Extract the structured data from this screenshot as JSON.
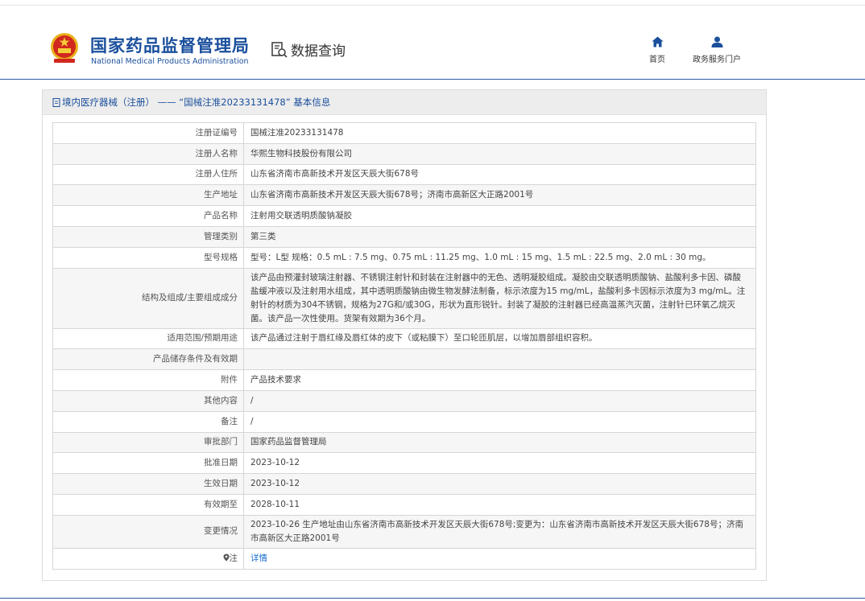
{
  "header": {
    "logo_cn": "国家药品监督管理局",
    "logo_en": "National Medical Products Administration",
    "query_label": "数据查询",
    "nav": {
      "home": "首页",
      "portal": "政务服务门户"
    }
  },
  "panel": {
    "title": "境内医疗器械（注册） —— “国械注准20233131478” 基本信息"
  },
  "rows": [
    {
      "label": "注册证编号",
      "value": "国械注准20233131478"
    },
    {
      "label": "注册人名称",
      "value": "华熙生物科技股份有限公司"
    },
    {
      "label": "注册人住所",
      "value": "山东省济南市高新技术开发区天辰大街678号"
    },
    {
      "label": "生产地址",
      "value": "山东省济南市高新技术开发区天辰大街678号；济南市高新区大正路2001号"
    },
    {
      "label": "产品名称",
      "value": "注射用交联透明质酸钠凝胶"
    },
    {
      "label": "管理类别",
      "value": "第三类"
    },
    {
      "label": "型号规格",
      "value": "型号：L型 规格：0.5 mL : 7.5 mg、0.75 mL : 11.25 mg、1.0 mL : 15 mg、1.5 mL : 22.5 mg、2.0 mL : 30 mg。"
    },
    {
      "label": "结构及组成/主要组成成分",
      "value": "该产品由预灌封玻璃注射器、不锈钢注射针和封装在注射器中的无色、透明凝胶组成。凝胶由交联透明质酸钠、盐酸利多卡因、磷酸盐缓冲液以及注射用水组成，其中透明质酸钠由微生物发酵法制备，标示浓度为15 mg/mL，盐酸利多卡因标示浓度为3 mg/mL。注射针的材质为304不锈钢，规格为27G和/或30G，形状为直形锐针。封装了凝胶的注射器已经高温蒸汽灭菌，注射针已环氧乙烷灭菌。该产品一次性使用。货架有效期为36个月。"
    },
    {
      "label": "适用范围/预期用途",
      "value": "该产品通过注射于唇红缘及唇红体的皮下（或粘膜下）至口轮匝肌层，以增加唇部组织容积。"
    },
    {
      "label": "产品储存条件及有效期",
      "value": ""
    },
    {
      "label": "附件",
      "value": "产品技术要求"
    },
    {
      "label": "其他内容",
      "value": "/"
    },
    {
      "label": "备注",
      "value": "/"
    },
    {
      "label": "审批部门",
      "value": "国家药品监督管理局"
    },
    {
      "label": "批准日期",
      "value": "2023-10-12"
    },
    {
      "label": "生效日期",
      "value": "2023-10-12"
    },
    {
      "label": "有效期至",
      "value": "2028-10-11"
    },
    {
      "label": "变更情况",
      "value": "2023-10-26 生产地址由山东省济南市高新技术开发区天辰大街678号;变更为：山东省济南市高新技术开发区天辰大街678号；济南市高新区大正路2001号"
    }
  ],
  "note": {
    "label": "注",
    "link": "详情"
  },
  "icons": {
    "emblem": "national-emblem-icon",
    "query": "document-search-icon",
    "home": "home-icon",
    "portal": "user-icon",
    "title": "document-icon",
    "note": "location-pin-icon"
  },
  "colors": {
    "brand": "#1a4f9c",
    "link": "#1a6fd0",
    "title_bar": "#ededed"
  }
}
